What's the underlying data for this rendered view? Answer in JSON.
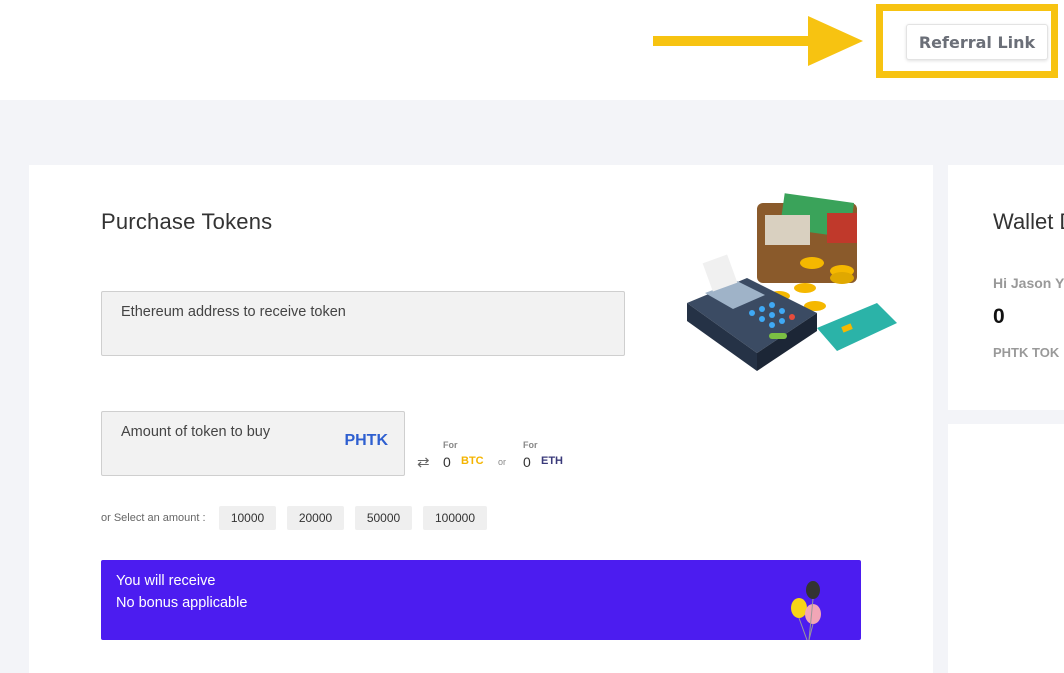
{
  "header": {
    "referral_label": "Referral Link"
  },
  "purchase": {
    "title": "Purchase Tokens",
    "address_placeholder": "Ethereum address to receive token",
    "amount_placeholder": "Amount of token to buy",
    "token_symbol": "PHTK",
    "conversion": {
      "for_label": "For",
      "or_label": "or",
      "btc_value": "0",
      "btc_symbol": "BTC",
      "eth_value": "0",
      "eth_symbol": "ETH"
    },
    "select_label": "or Select an amount :",
    "amounts": [
      "10000",
      "20000",
      "50000",
      "100000"
    ],
    "receive": {
      "line1": "You will receive",
      "line2": "No bonus applicable"
    }
  },
  "wallet": {
    "title": "Wallet D",
    "greeting": "Hi Jason Y",
    "balance": "0",
    "unit": "PHTK TOK"
  },
  "colors": {
    "accent_yellow": "#f7c311",
    "banner_purple": "#4c1cf0",
    "token_blue": "#2e5fd0",
    "btc_gold": "#f4b400",
    "eth_navy": "#3a3a7a"
  },
  "icons": [
    "arrow-right-icon",
    "swap-icon",
    "wallet-illustration",
    "balloon-icon"
  ]
}
